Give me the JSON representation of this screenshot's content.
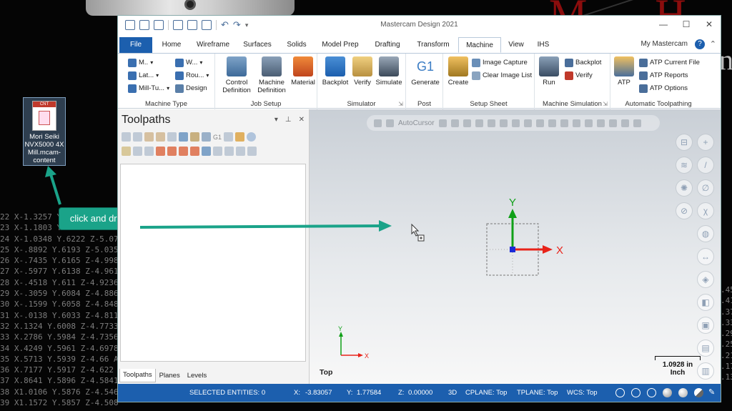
{
  "desktop": {
    "icon_label": "Mori Seiki NVX5000 4X Mill.mcam-content",
    "icon_badge": "CNT",
    "gcode_lines": [
      "22 X-1.3257 Y",
      "23 X-1.1803 Y",
      "24 X-1.0348 Y.6222 Z-5.07",
      "25 X-.8892 Y.6193 Z-5.035",
      "26 X-.7435 Y.6165 Z-4.998",
      "27 X-.5977 Y.6138 Z-4.961",
      "28 X-.4518 Y.611 Z-4.9236",
      "29 X-.3059 Y.6084 Z-4.886",
      "30 X-.1599 Y.6058 Z-4.848",
      "31 X-.0138 Y.6033 Z-4.811",
      "32 X.1324 Y.6008 Z-4.7733",
      "33 X.2786 Y.5984 Z-4.7356",
      "34 X.4249 Y.5961 Z-4.6978",
      "35 X.5713 Y.5939 Z-4.66 A",
      "36 X.7177 Y.5917 Z-4.622",
      "37 X.8641 Y.5896 Z-4.5841",
      "38 X1.0106 Y.5876 Z-4.546",
      "39 X1.1572 Y.5857 Z-4.508"
    ],
    "gcode_right": [
      ".45",
      ".41",
      ".37",
      ".33",
      ".29",
      ".25",
      ".21",
      ".17",
      ".13"
    ]
  },
  "callout": {
    "text": "click and drag"
  },
  "window": {
    "title": "Mastercam Design 2021",
    "controls": [
      "—",
      "☐",
      "✕"
    ]
  },
  "tabs": [
    {
      "label": "File"
    },
    {
      "label": "Home"
    },
    {
      "label": "Wireframe"
    },
    {
      "label": "Surfaces"
    },
    {
      "label": "Solids"
    },
    {
      "label": "Model Prep"
    },
    {
      "label": "Drafting"
    },
    {
      "label": "Transform"
    },
    {
      "label": "Machine"
    },
    {
      "label": "View"
    },
    {
      "label": "IHS"
    }
  ],
  "my_mastercam": "My Mastercam",
  "ribbon": {
    "machine_type": {
      "label": "Machine Type",
      "items": [
        "M..",
        "Lat...",
        "Mill-Tu...",
        "W...",
        "Rou...",
        "Design"
      ]
    },
    "job_setup": {
      "label": "Job Setup",
      "control_definition": "Control Definition",
      "machine_definition": "Machine Definition",
      "material": "Material"
    },
    "simulator": {
      "label": "Simulator",
      "backplot": "Backplot",
      "verify": "Verify",
      "simulate": "Simulate"
    },
    "post": {
      "label": "Post",
      "g1": "G1",
      "generate": "Generate"
    },
    "setup_sheet": {
      "label": "Setup Sheet",
      "create": "Create",
      "image_capture": "Image Capture",
      "clear_image_list": "Clear Image List"
    },
    "machine_simulation": {
      "label": "Machine Simulation",
      "run": "Run",
      "backplot": "Backplot",
      "verify": "Verify"
    },
    "automatic_toolpathing": {
      "label": "Automatic Toolpathing",
      "atp": "ATP",
      "current_file": "ATP Current File",
      "reports": "ATP Reports",
      "options": "ATP Options"
    }
  },
  "toolpaths_panel": {
    "title": "Toolpaths",
    "tabs": [
      "Toolpaths",
      "Planes",
      "Levels"
    ]
  },
  "graphics": {
    "autocursor": "AutoCursor",
    "view_name": "Top",
    "scale_value": "1.0928 in",
    "scale_unit": "Inch",
    "axis_x": "X",
    "axis_y": "Y"
  },
  "status": {
    "selected": "SELECTED ENTITIES: 0",
    "x_label": "X:",
    "x_value": "-3.83057",
    "y_label": "Y:",
    "y_value": "1.77584",
    "z_label": "Z:",
    "z_value": "0.00000",
    "mode": "3D",
    "cplane": "CPLANE: Top",
    "tplane": "TPLANE: Top",
    "wcs": "WCS: Top"
  },
  "colors": {
    "accent": "#1c5fae",
    "callout": "#1aa389",
    "axis_x": "#e8231a",
    "axis_y": "#10a018"
  }
}
